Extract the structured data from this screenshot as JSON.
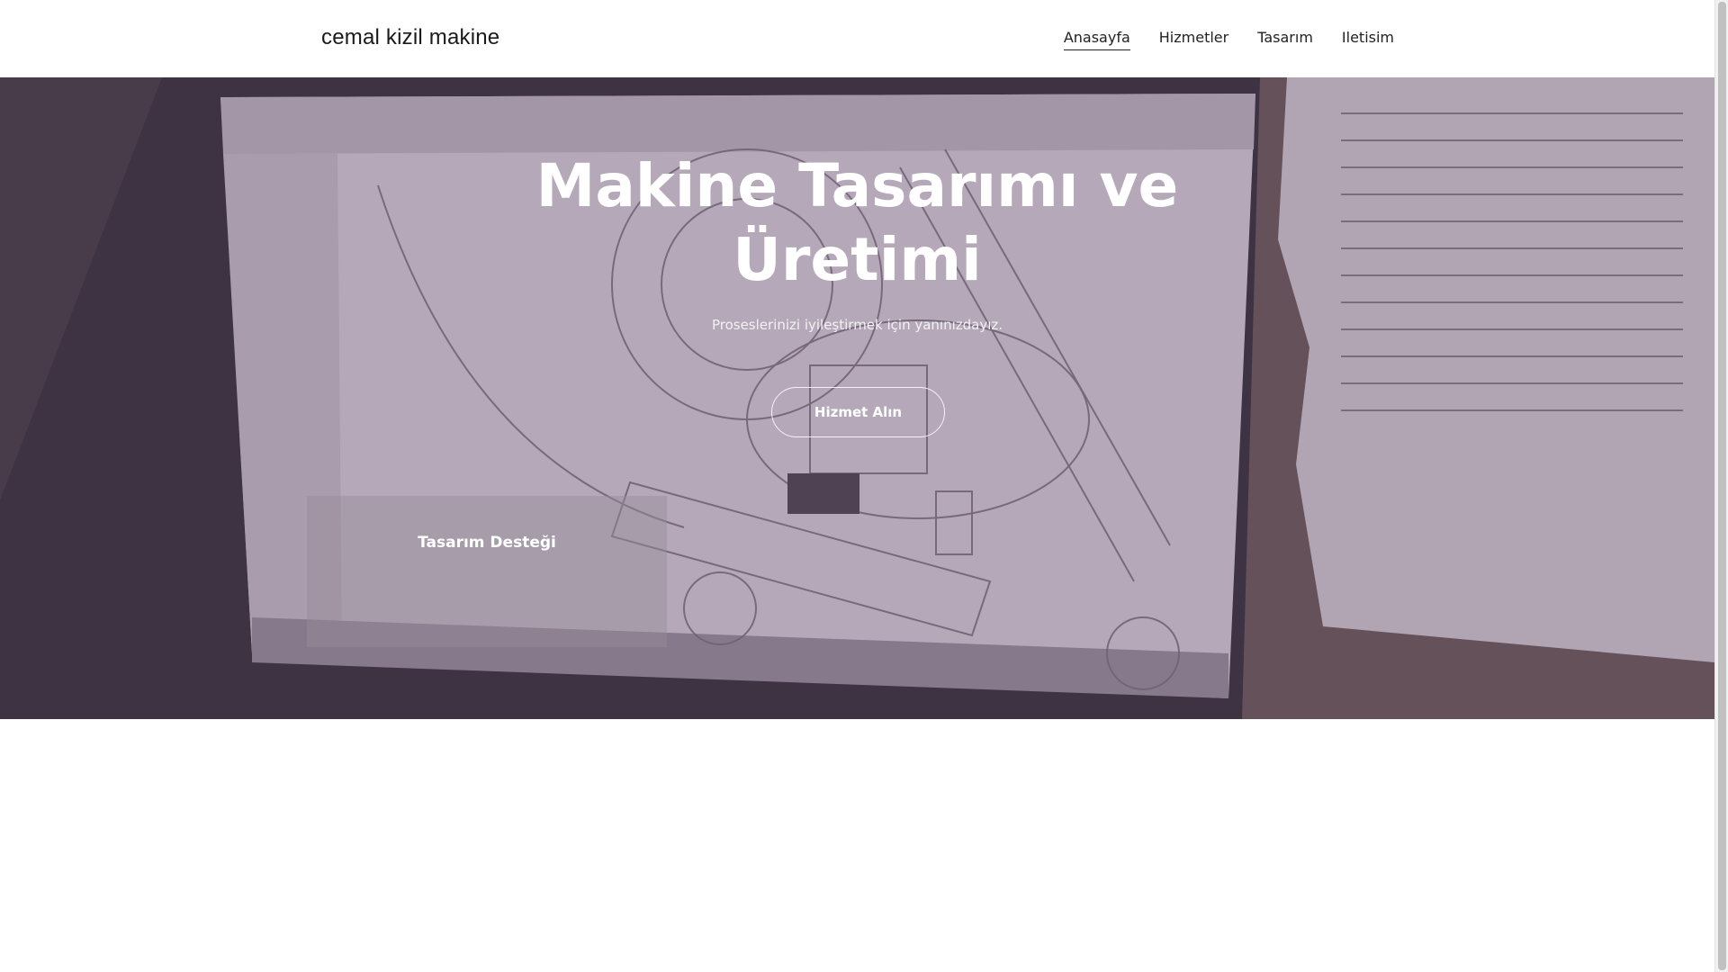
{
  "header": {
    "brand": "cemal kizil makine",
    "nav": [
      {
        "label": "Anasayfa",
        "active": true
      },
      {
        "label": "Hizmetler",
        "active": false
      },
      {
        "label": "Tasarım",
        "active": false
      },
      {
        "label": "Iletisim",
        "active": false
      }
    ]
  },
  "hero": {
    "title_line1": "Makine Tasarımı ve",
    "title_line2": "Üretimi",
    "subtitle": "Proseslerinizi iyileştirmek için yanınızdayız.",
    "cta_label": "Hizmet Alın"
  },
  "card": {
    "title": "Tasarım Desteği"
  },
  "colors": {
    "overlay": "#785f7d",
    "text": "#1a1a1a",
    "hero_text": "#ffffff"
  }
}
